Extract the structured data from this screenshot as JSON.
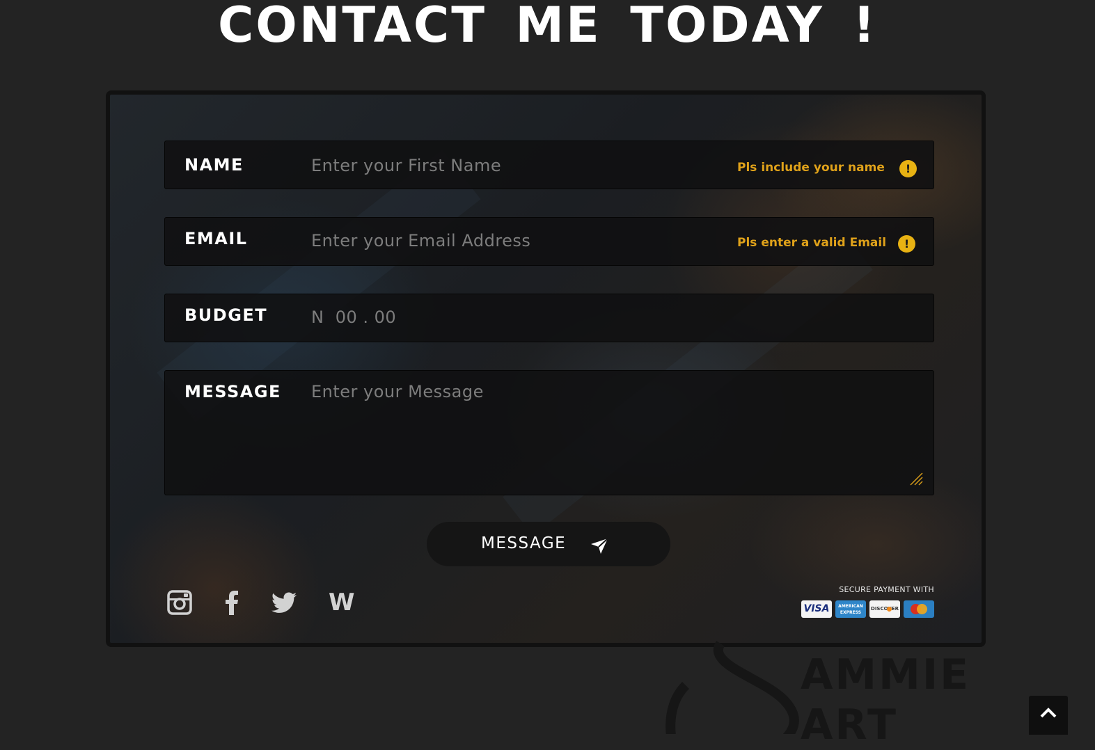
{
  "page": {
    "heading": "CONTACT ME TODAY !"
  },
  "form": {
    "name": {
      "label": "NAME",
      "placeholder": "Enter your First Name",
      "error": "Pls include your name",
      "error_icon": "exclamation-circle-icon"
    },
    "email": {
      "label": "EMAIL",
      "placeholder": "Enter your Email Address",
      "error": "Pls enter a valid Email",
      "error_icon": "exclamation-circle-icon"
    },
    "budget": {
      "label": "BUDGET",
      "placeholder": "N  00 . 00"
    },
    "message": {
      "label": "MESSAGE",
      "placeholder": "Enter your Message"
    },
    "submit": {
      "label": "MESSAGE",
      "icon": "paper-plane-icon"
    }
  },
  "social": {
    "items": [
      {
        "name": "instagram",
        "icon": "instagram-icon"
      },
      {
        "name": "facebook",
        "icon": "facebook-icon"
      },
      {
        "name": "twitter",
        "icon": "twitter-icon"
      },
      {
        "name": "w",
        "icon": "w-icon",
        "glyph": "W"
      }
    ]
  },
  "payment": {
    "label": "SECURE PAYMENT WITH",
    "cards": [
      {
        "name": "visa",
        "text": "VISA"
      },
      {
        "name": "american-express",
        "text": "AMERICAN EXPRESS"
      },
      {
        "name": "discover",
        "text": "DISCOVER"
      },
      {
        "name": "mastercard",
        "text": "MasterCard"
      }
    ]
  },
  "watermark": {
    "line1": "AMMIE",
    "line2": "ART"
  },
  "colors": {
    "background": "#232323",
    "accent_warning": "#e0a21a",
    "text": "#ffffff",
    "placeholder": "#7d7d7d"
  }
}
